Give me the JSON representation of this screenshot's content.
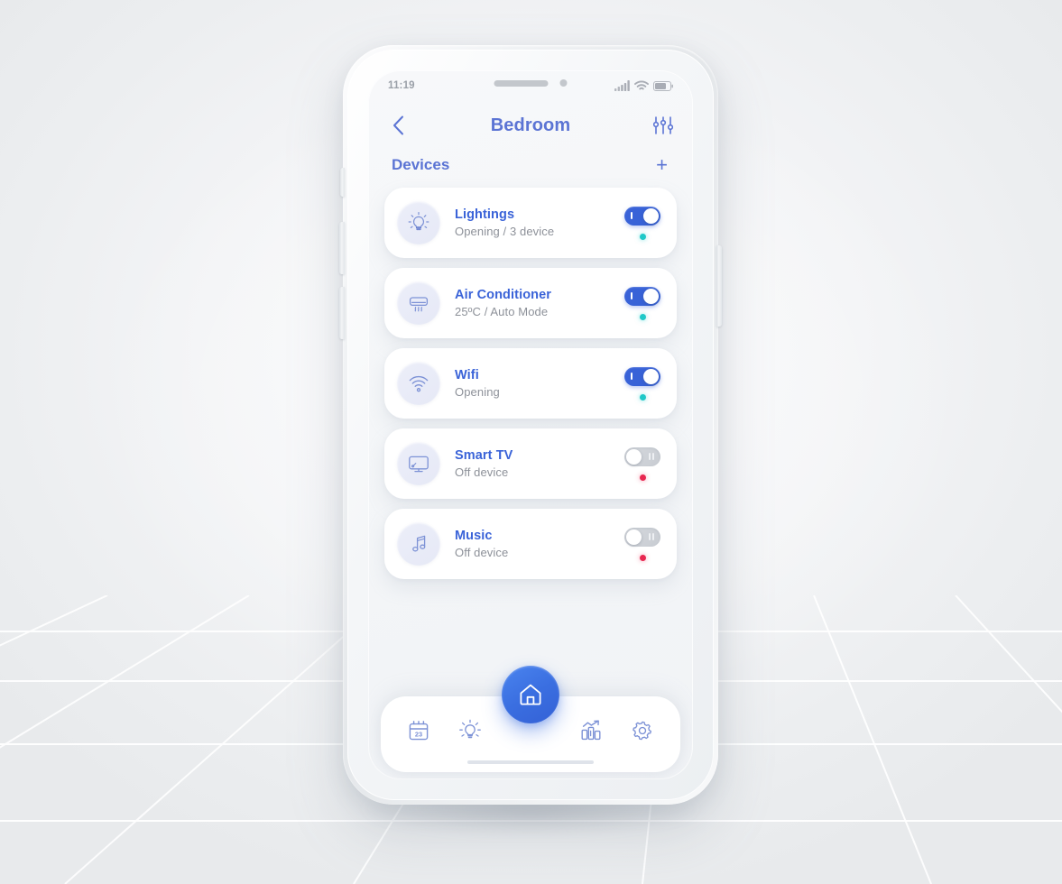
{
  "status_bar": {
    "time": "11:19",
    "icons": [
      "signal-bars-icon",
      "wifi-icon",
      "battery-icon"
    ]
  },
  "header": {
    "back_icon": "chevron-left-icon",
    "title": "Bedroom",
    "filter_icon": "sliders-icon"
  },
  "section": {
    "title": "Devices",
    "add_label": "+"
  },
  "devices": [
    {
      "name": "Lightings",
      "status": "Opening / 3 device",
      "icon": "lightbulb-icon",
      "toggle": "on",
      "dot": "online"
    },
    {
      "name": "Air Conditioner",
      "status": "25ºC / Auto Mode",
      "icon": "air-conditioner-icon",
      "toggle": "on",
      "dot": "online"
    },
    {
      "name": "Wifi",
      "status": "Opening",
      "icon": "wifi-icon",
      "toggle": "on",
      "dot": "online"
    },
    {
      "name": "Smart TV",
      "status": "Off device",
      "icon": "tv-icon",
      "toggle": "off",
      "dot": "offline"
    },
    {
      "name": "Music",
      "status": "Off device",
      "icon": "music-note-icon",
      "toggle": "off",
      "dot": "offline"
    }
  ],
  "bottom_nav": {
    "items": [
      {
        "icon": "calendar-icon",
        "badge": "23"
      },
      {
        "icon": "lightbulb-icon"
      },
      {
        "icon": "home-icon",
        "active": true
      },
      {
        "icon": "bar-chart-icon"
      },
      {
        "icon": "gear-icon"
      }
    ]
  },
  "colors": {
    "accent_blue": "#3a63d8",
    "title_blue": "#5b74d4",
    "fab_blue": "#3a6ee0",
    "status_online": "#1ec8c8",
    "status_offline": "#e8264f",
    "muted_text": "#8d9199",
    "icon_tint": "#7d92d6",
    "card_bg": "#ffffff",
    "screen_bg": "#f4f6f8"
  }
}
